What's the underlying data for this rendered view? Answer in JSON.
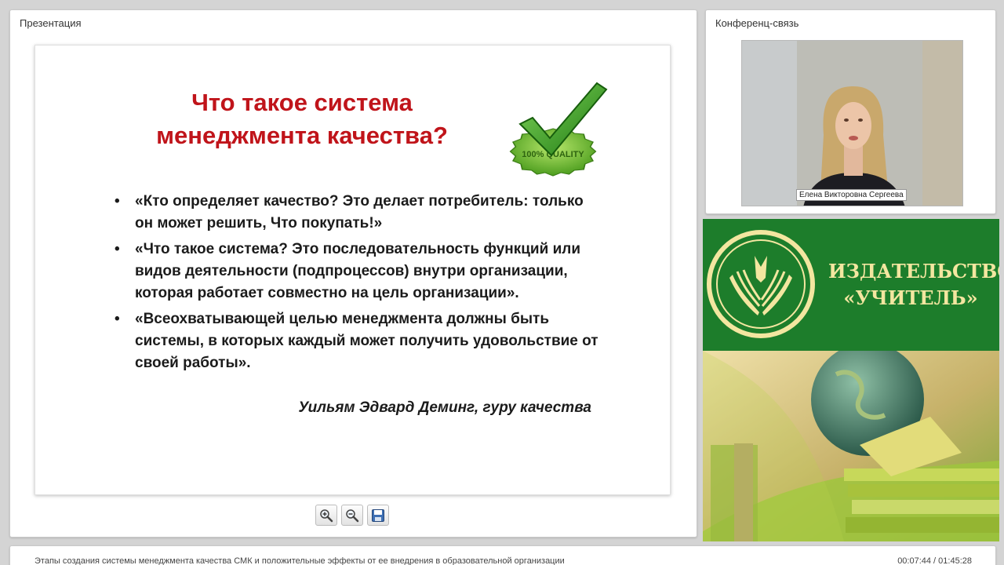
{
  "presentation": {
    "title": "Презентация",
    "slide": {
      "heading_line1": "Что такое система",
      "heading_line2": "менеджмента качества?",
      "badge_text": "100% QUALITY",
      "bullets": [
        "«Кто определяет качество? Это делает потребитель: только он может решить, Что покупать!»",
        "«Что такое система? Это последовательность функций или видов деятельности (подпроцессов) внутри организации, которая работает совместно на цель организации».",
        "«Всеохватывающей целью менеджмента должны быть системы, в которых каждый может получить удовольствие от своей работы»."
      ],
      "author": "Уильям Эдвард Деминг, гуру качества"
    },
    "toolbar": {
      "zoom_in_icon": "zoom-in-icon",
      "zoom_out_icon": "zoom-out-icon",
      "save_icon": "save-icon"
    }
  },
  "conference": {
    "title": "Конференц-связь",
    "presenter_name": "Елена Викторовна Сергеева"
  },
  "banner": {
    "line1": "ИЗДАТЕЛЬСТВО",
    "line2": "«УЧИТЕЛЬ»",
    "colors": {
      "green": "#1d7d2b",
      "gold": "#f3e6a0"
    }
  },
  "footer": {
    "title": "Этапы создания системы менеджмента качества СМК и положительные эффекты от ее внедрения в образовательной организации",
    "time": "00:07:44 / 01:45:28"
  },
  "colors": {
    "heading_red": "#c0141a",
    "check_green": "#3fae2a"
  }
}
